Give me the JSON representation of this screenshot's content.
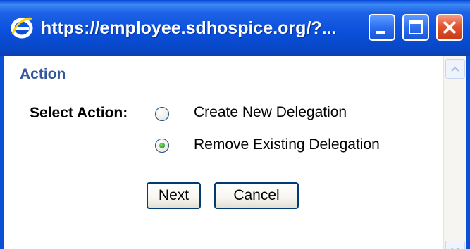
{
  "window": {
    "title": "https://employee.sdhospice.org/?...",
    "icon": "internet-explorer-icon",
    "controls": [
      "minimize-icon",
      "maximize-icon",
      "close-icon"
    ]
  },
  "page": {
    "section_title": "Action",
    "select_label": "Select Action:",
    "options": [
      {
        "label": "Create New Delegation",
        "selected": false
      },
      {
        "label": "Remove Existing Delegation",
        "selected": true
      }
    ],
    "buttons": {
      "next": "Next",
      "cancel": "Cancel"
    }
  },
  "colors": {
    "titlebar": "#0a50dc",
    "section_title": "#34589a",
    "radio_selected": "#31a62a",
    "close_button": "#e2542f"
  }
}
